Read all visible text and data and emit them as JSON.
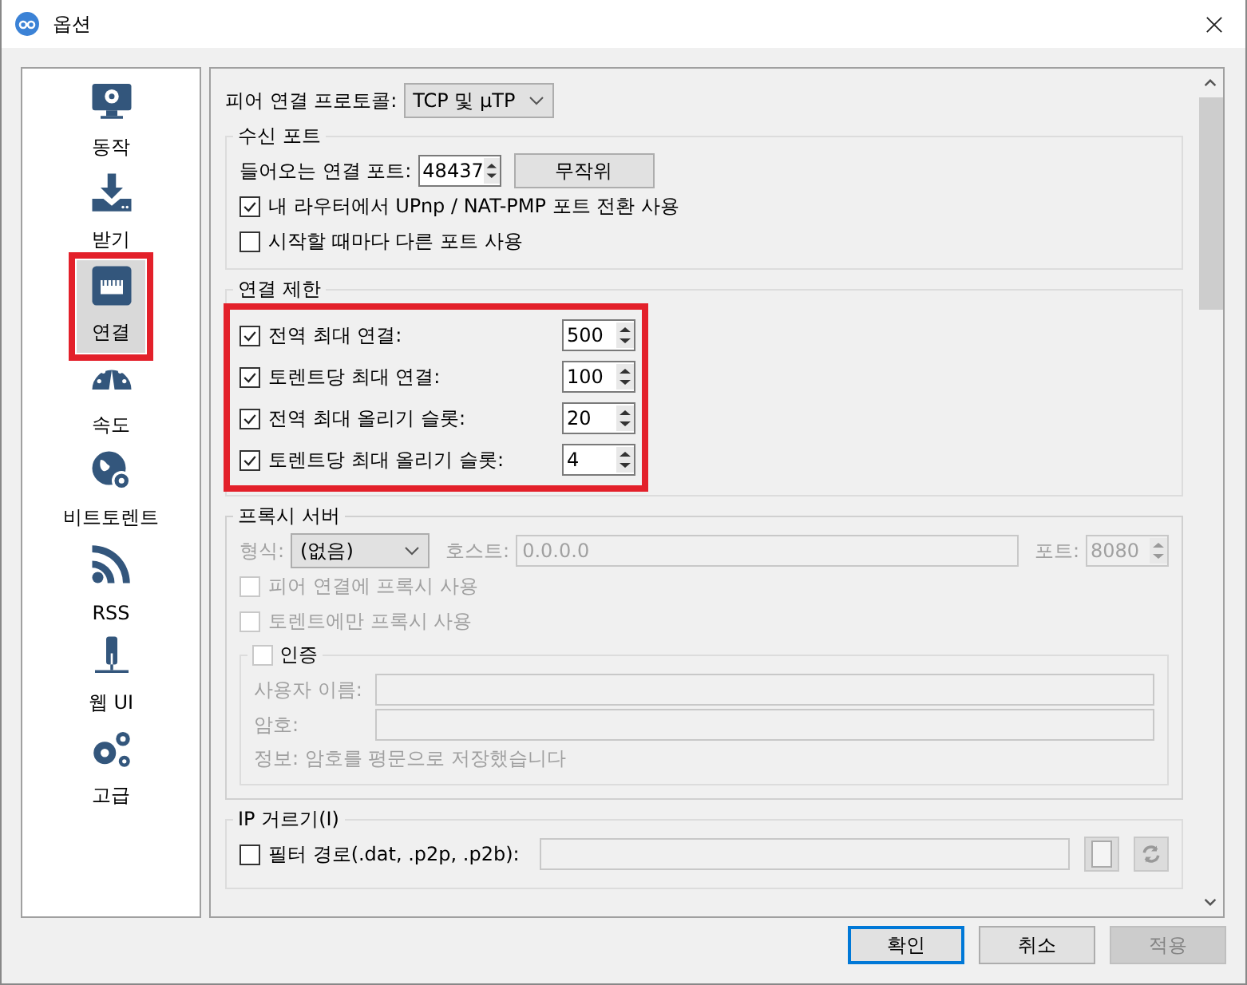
{
  "window": {
    "title": "옵션"
  },
  "sidebar": {
    "items": [
      {
        "label": "동작",
        "kind": "monitor",
        "selected": false,
        "highlighted": false
      },
      {
        "label": "받기",
        "kind": "download",
        "selected": false,
        "highlighted": false
      },
      {
        "label": "연결",
        "kind": "network",
        "selected": true,
        "highlighted": true
      },
      {
        "label": "속도",
        "kind": "speed",
        "selected": false,
        "highlighted": false
      },
      {
        "label": "비트토렌트",
        "kind": "globe",
        "selected": false,
        "highlighted": false
      },
      {
        "label": "RSS",
        "kind": "rss",
        "selected": false,
        "highlighted": false
      },
      {
        "label": "웹 UI",
        "kind": "webui",
        "selected": false,
        "highlighted": false
      },
      {
        "label": "고급",
        "kind": "gears",
        "selected": false,
        "highlighted": false
      }
    ]
  },
  "protocol": {
    "label": "피어 연결 프로토콜:",
    "value": "TCP 및 µTP"
  },
  "listening_port": {
    "title": "수신 포트",
    "port_label": "들어오는 연결 포트:",
    "port": "48437",
    "random_button": "무작위",
    "options": [
      {
        "label": "내 라우터에서 UPnp / NAT-PMP 포트 전환 사용",
        "checked": true
      },
      {
        "label": "시작할 때마다 다른 포트 사용",
        "checked": false
      }
    ]
  },
  "connection_limits": {
    "title": "연결 제한",
    "highlighted": true,
    "rows": [
      {
        "label": "전역 최대 연결:",
        "checked": true,
        "value": "500"
      },
      {
        "label": "토렌트당 최대 연결:",
        "checked": true,
        "value": "100"
      },
      {
        "label": "전역 최대 올리기 슬롯:",
        "checked": true,
        "value": "20"
      },
      {
        "label": "토렌트당 최대 올리기 슬롯:",
        "checked": true,
        "value": "4"
      }
    ]
  },
  "proxy": {
    "title": "프록시 서버",
    "disabled": true,
    "type_label": "형식:",
    "type": "(없음)",
    "host_label": "호스트:",
    "host": "0.0.0.0",
    "port_label": "포트:",
    "port": "8080",
    "options": [
      {
        "label": "피어 연결에 프록시 사용",
        "checked": false
      },
      {
        "label": "토렌트에만 프록시 사용",
        "checked": false
      }
    ],
    "auth": {
      "label": "인증",
      "checked": false,
      "username_label": "사용자 이름:",
      "password_label": "암호:",
      "info": "정보: 암호를 평문으로 저장했습니다"
    }
  },
  "ip_filter": {
    "title": "IP 거르기(I)",
    "label": "필터 경로(.dat, .p2p, .p2b):",
    "checked": false
  },
  "buttons": [
    {
      "label": "확인",
      "kind": "default",
      "disabled": false
    },
    {
      "label": "취소",
      "kind": "normal",
      "disabled": false
    },
    {
      "label": "적용",
      "kind": "normal",
      "disabled": true
    }
  ]
}
